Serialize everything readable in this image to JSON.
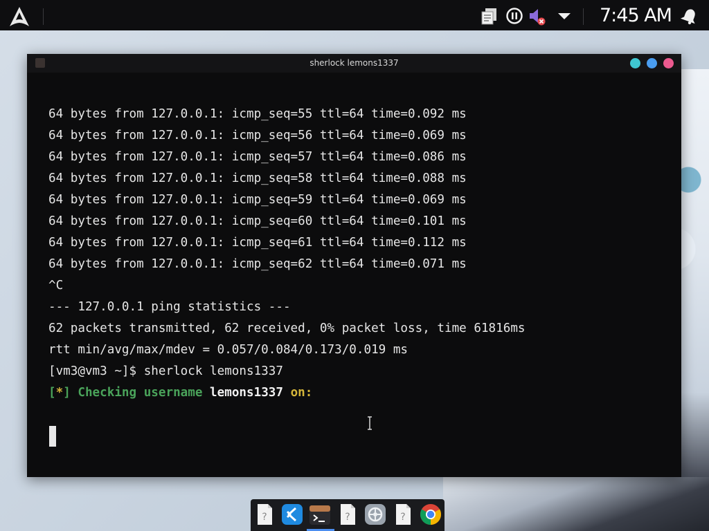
{
  "panel": {
    "clock": "7:45 AM",
    "icons": [
      "arch-logo-icon",
      "clipboard-icon",
      "pause-icon",
      "volume-muted-icon",
      "dropdown-arrow-icon",
      "notifications-icon"
    ]
  },
  "window": {
    "title": "sherlock lemons1337",
    "buttons": [
      "minimize",
      "maximize",
      "close"
    ],
    "button_colors": {
      "minimize": "#3fc7d1",
      "maximize": "#4a9df0",
      "close": "#ec5a8f"
    }
  },
  "terminal": {
    "lines": [
      "64 bytes from 127.0.0.1: icmp_seq=55 ttl=64 time=0.092 ms",
      "64 bytes from 127.0.0.1: icmp_seq=56 ttl=64 time=0.069 ms",
      "64 bytes from 127.0.0.1: icmp_seq=57 ttl=64 time=0.086 ms",
      "64 bytes from 127.0.0.1: icmp_seq=58 ttl=64 time=0.088 ms",
      "64 bytes from 127.0.0.1: icmp_seq=59 ttl=64 time=0.069 ms",
      "64 bytes from 127.0.0.1: icmp_seq=60 ttl=64 time=0.101 ms",
      "64 bytes from 127.0.0.1: icmp_seq=61 ttl=64 time=0.112 ms",
      "64 bytes from 127.0.0.1: icmp_seq=62 ttl=64 time=0.071 ms",
      "^C",
      "--- 127.0.0.1 ping statistics ---",
      "62 packets transmitted, 62 received, 0% packet loss, time 61816ms",
      "rtt min/avg/max/mdev = 0.057/0.084/0.173/0.019 ms",
      "[vm3@vm3 ~]$ sherlock lemons1337"
    ],
    "status": {
      "bracket_open": "[",
      "star": "*",
      "bracket_close": "]",
      "checking": "Checking username",
      "username": "lemons1337",
      "on": "on:"
    }
  },
  "dock": {
    "items": [
      "unknown-file-icon",
      "vscode-icon",
      "terminal-icon",
      "unknown-file-icon",
      "settings-icon",
      "unknown-file-icon",
      "chrome-icon"
    ]
  },
  "colors": {
    "terminal_bg": "#0c0c0d",
    "prompt_green": "#4aa35a",
    "on_yellow": "#d5b63a"
  }
}
